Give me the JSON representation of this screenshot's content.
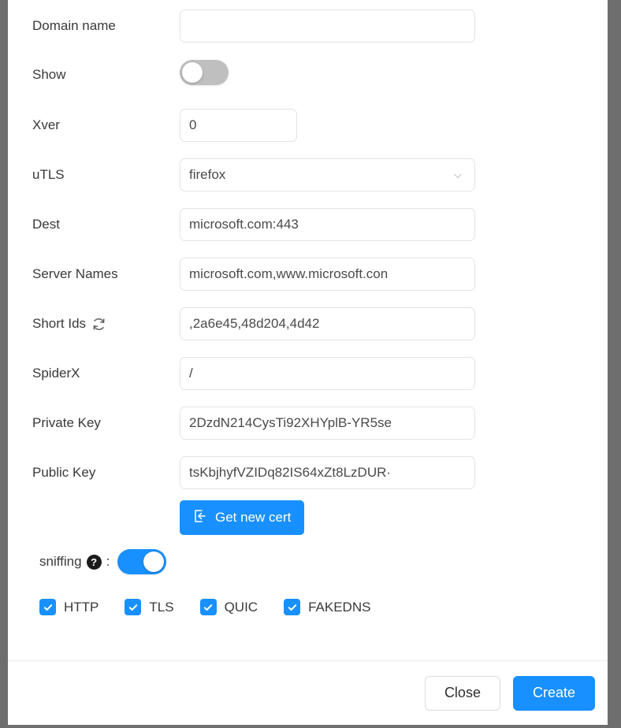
{
  "theme": {
    "accent": "#1890ff",
    "border": "#e2e3e5",
    "text": "#39393a",
    "toggle_off": "#bfbfbf",
    "window_chrome": "#6e6e6e",
    "spellcheck_underline": "#e84a3f"
  },
  "form": {
    "fields": [
      {
        "label": "Domain name",
        "value": "",
        "type": "text"
      },
      {
        "label": "Show",
        "value": "off",
        "type": "switch"
      },
      {
        "label": "Xver",
        "value": "0",
        "type": "text-narrow"
      },
      {
        "label": "uTLS",
        "value": "firefox",
        "type": "select"
      },
      {
        "label": "Dest",
        "value": "microsoft.com:443",
        "type": "text"
      },
      {
        "label": "Server Names",
        "value": "microsoft.com,www.microsoft.con",
        "type": "text-spell"
      },
      {
        "label": "Short Ids",
        "value": ",2a6e45,48d204,4d42",
        "type": "text",
        "icon": "refresh-icon"
      },
      {
        "label": "SpiderX",
        "value": "/",
        "type": "text"
      },
      {
        "label": "Private Key",
        "value": "2DzdN214CysTi92XHYplB-YR5se",
        "type": "text"
      },
      {
        "label": "Public Key",
        "value": "tsKbjhyfVZIDq82IS64xZt8LzDUR·",
        "type": "text"
      }
    ],
    "cert_button": {
      "label": "Get new cert",
      "icon": "import-arrow-icon"
    },
    "sniffing": {
      "label": "sniffing",
      "help_icon": "question-mark-icon",
      "colon": ":",
      "value": "on"
    },
    "protocols": [
      {
        "label": "HTTP",
        "checked": true
      },
      {
        "label": "TLS",
        "checked": true
      },
      {
        "label": "QUIC",
        "checked": true
      },
      {
        "label": "FAKEDNS",
        "checked": true
      }
    ]
  },
  "footer": {
    "close_label": "Close",
    "create_label": "Create"
  }
}
